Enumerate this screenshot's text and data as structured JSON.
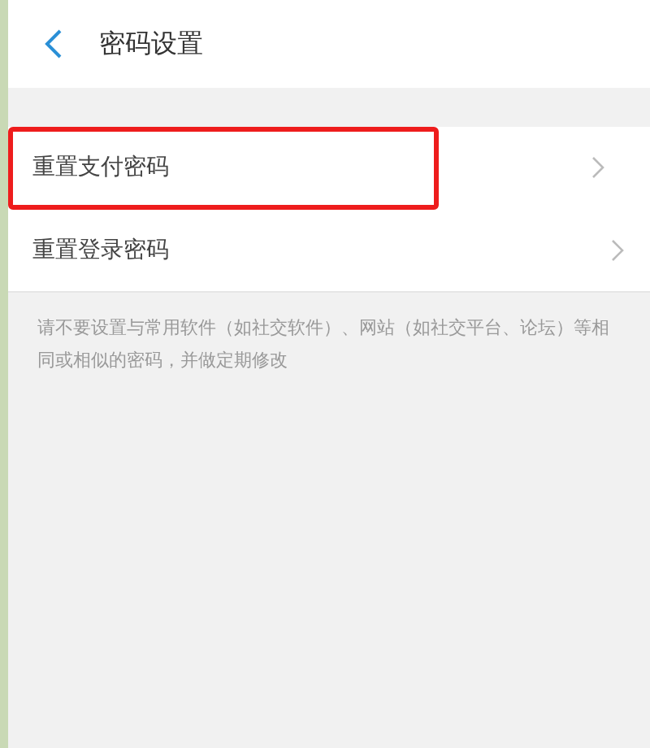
{
  "header": {
    "title": "密码设置"
  },
  "items": [
    {
      "label": "重置支付密码",
      "highlighted": true
    },
    {
      "label": "重置登录密码",
      "highlighted": false
    }
  ],
  "note": "请不要设置与常用软件（如社交软件）、网站（如社交平台、论坛）等相同或相似的密码，并做定期修改"
}
